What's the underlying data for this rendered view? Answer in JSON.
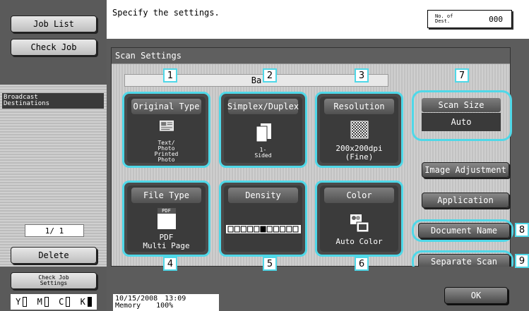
{
  "sidebar": {
    "job_list": "Job List",
    "check_job": "Check Job",
    "broadcast_title": "Broadcast\nDestinations",
    "page_counter": "1/ 1",
    "delete": "Delete",
    "check_job_settings": "Check Job\nSettings",
    "toner": [
      {
        "label": "Y",
        "level": 0.1
      },
      {
        "label": "M",
        "level": 0.1
      },
      {
        "label": "C",
        "level": 0.1
      },
      {
        "label": "K",
        "level": 1.0
      }
    ]
  },
  "header": {
    "message": "Specify the settings.",
    "dest_label": "No. of\nDest.",
    "dest_count": "000"
  },
  "scan_settings": {
    "title": "Scan Settings",
    "basic_tab": "Ba",
    "cards": {
      "original_type": {
        "title": "Original Type",
        "value": "Text/\nPhoto\nPrinted\nPhoto",
        "icon": "document-photo-icon"
      },
      "simplex_duplex": {
        "title": "Simplex/Duplex",
        "value": "1-\nSided",
        "icon": "pages-icon"
      },
      "resolution": {
        "title": "Resolution",
        "value": "200x200dpi\n(Fine)",
        "icon": "checker-icon"
      },
      "file_type": {
        "title": "File Type",
        "value": "PDF\nMulti Page",
        "icon_text": "PDF",
        "icon": "pdf-file-icon"
      },
      "density": {
        "title": "Density",
        "level": 0.5,
        "icon": "density-scale-icon"
      },
      "color": {
        "title": "Color",
        "value": "Auto Color",
        "icon": "auto-color-icon"
      }
    },
    "scan_size": {
      "title": "Scan Size",
      "value": "Auto"
    },
    "buttons": {
      "image_adjustment": "Image Adjustment",
      "application": "Application",
      "document_name": "Document Name",
      "separate_scan": "Separate Scan"
    }
  },
  "callouts": [
    "1",
    "2",
    "3",
    "4",
    "5",
    "6",
    "7",
    "8",
    "9"
  ],
  "footer": {
    "date": "10/15/2008",
    "time": "13:09",
    "memory_label": "Memory",
    "memory_value": "100%",
    "ok": "OK"
  },
  "colors": {
    "highlight": "#4fd8e8",
    "panel": "#5c5c5c"
  }
}
